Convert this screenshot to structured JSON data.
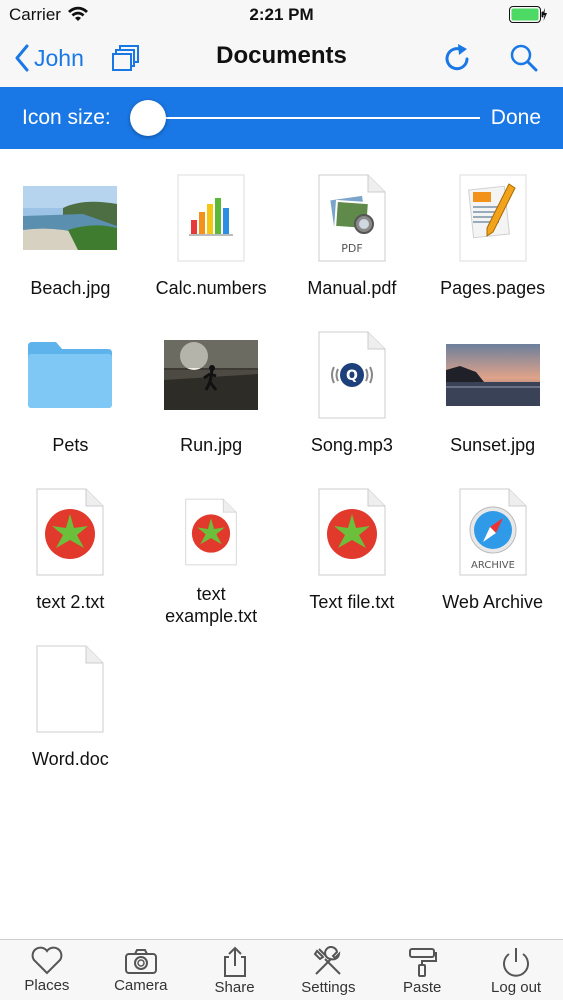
{
  "status": {
    "carrier": "Carrier",
    "time": "2:21 PM"
  },
  "nav": {
    "back_label": "John",
    "title": "Documents"
  },
  "icon_size": {
    "label": "Icon size:",
    "done_label": "Done",
    "slider_value": 0
  },
  "files": [
    {
      "name": "Beach.jpg",
      "icon": "beach-photo-icon"
    },
    {
      "name": "Calc.numbers",
      "icon": "numbers-icon"
    },
    {
      "name": "Manual.pdf",
      "icon": "pdf-icon",
      "badge": "PDF"
    },
    {
      "name": "Pages.pages",
      "icon": "pages-icon"
    },
    {
      "name": "Pets",
      "icon": "folder-icon"
    },
    {
      "name": "Run.jpg",
      "icon": "run-photo-icon"
    },
    {
      "name": "Song.mp3",
      "icon": "audio-file-icon"
    },
    {
      "name": "Sunset.jpg",
      "icon": "sunset-photo-icon"
    },
    {
      "name": "text 2.txt",
      "icon": "text-file-icon"
    },
    {
      "name": "text example.txt",
      "icon": "text-file-icon"
    },
    {
      "name": "Text file.txt",
      "icon": "text-file-icon"
    },
    {
      "name": "Web Archive",
      "icon": "web-archive-icon",
      "badge": "ARCHIVE"
    },
    {
      "name": "Word.doc",
      "icon": "blank-document-icon"
    }
  ],
  "tabs": [
    {
      "label": "Places",
      "icon": "heart-icon"
    },
    {
      "label": "Camera",
      "icon": "camera-icon"
    },
    {
      "label": "Share",
      "icon": "share-icon"
    },
    {
      "label": "Settings",
      "icon": "tools-icon"
    },
    {
      "label": "Paste",
      "icon": "paint-roller-icon"
    },
    {
      "label": "Log out",
      "icon": "power-icon"
    }
  ],
  "colors": {
    "accent": "#1a78e6",
    "bar_bg": "#f7f7f7",
    "folder": "#7fc7f4",
    "battery": "#4cd964"
  }
}
